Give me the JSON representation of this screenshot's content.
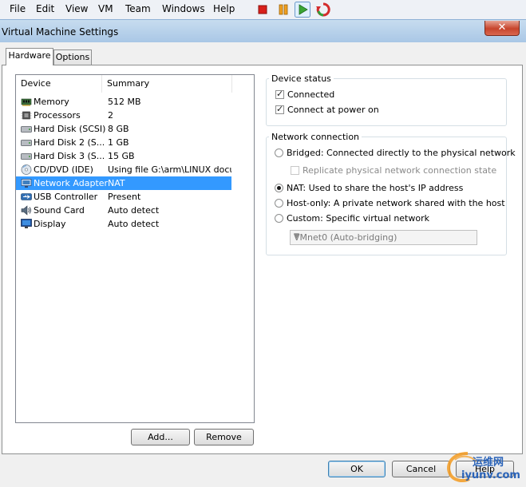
{
  "menubar": {
    "items": [
      "File",
      "Edit",
      "View",
      "VM",
      "Team",
      "Windows",
      "Help"
    ]
  },
  "window": {
    "title": "Virtual Machine Settings"
  },
  "tabs": [
    {
      "label": "Hardware",
      "active": true
    },
    {
      "label": "Options",
      "active": false
    }
  ],
  "device_list": {
    "columns": [
      "Device",
      "Summary"
    ],
    "rows": [
      {
        "device": "Memory",
        "summary": "512 MB",
        "icon": "memory-icon"
      },
      {
        "device": "Processors",
        "summary": "2",
        "icon": "processor-icon"
      },
      {
        "device": "Hard Disk (SCSI)",
        "summary": "8 GB",
        "icon": "hard-disk-icon"
      },
      {
        "device": "Hard Disk 2 (S...",
        "summary": "1 GB",
        "icon": "hard-disk-icon"
      },
      {
        "device": "Hard Disk 3 (S...",
        "summary": "15 GB",
        "icon": "hard-disk-icon"
      },
      {
        "device": "CD/DVD (IDE)",
        "summary": "Using file G:\\arm\\LINUX docu...",
        "icon": "cd-dvd-icon"
      },
      {
        "device": "Network Adapter",
        "summary": "NAT",
        "icon": "network-adapter-icon",
        "selected": true
      },
      {
        "device": "USB Controller",
        "summary": "Present",
        "icon": "usb-icon"
      },
      {
        "device": "Sound Card",
        "summary": "Auto detect",
        "icon": "sound-card-icon"
      },
      {
        "device": "Display",
        "summary": "Auto detect",
        "icon": "display-icon"
      }
    ],
    "add_label": "Add...",
    "remove_label": "Remove"
  },
  "device_status": {
    "legend": "Device status",
    "connected": {
      "label": "Connected",
      "checked": true
    },
    "connect_at_power_on": {
      "label": "Connect at power on",
      "checked": true
    }
  },
  "network_connection": {
    "legend": "Network connection",
    "bridged": {
      "label": "Bridged: Connected directly to the physical network",
      "checked": false
    },
    "replicate": {
      "label": "Replicate physical network connection state",
      "checked": false,
      "disabled": true
    },
    "nat": {
      "label": "NAT: Used to share the host's IP address",
      "checked": true
    },
    "host_only": {
      "label": "Host-only: A private network shared with the host",
      "checked": false
    },
    "custom": {
      "label": "Custom: Specific virtual network",
      "checked": false
    },
    "vmnet_select": {
      "value": "VMnet0 (Auto-bridging)",
      "disabled": true
    }
  },
  "footer": {
    "ok_label": "OK",
    "cancel_label": "Cancel",
    "help_label": "Help"
  },
  "watermark": {
    "cn_text": "运维网",
    "url_text": "iyunv.com"
  },
  "colors": {
    "selection": "#3399ff",
    "close_button": "#c7442c",
    "titlebar": "#a9c7e6"
  }
}
